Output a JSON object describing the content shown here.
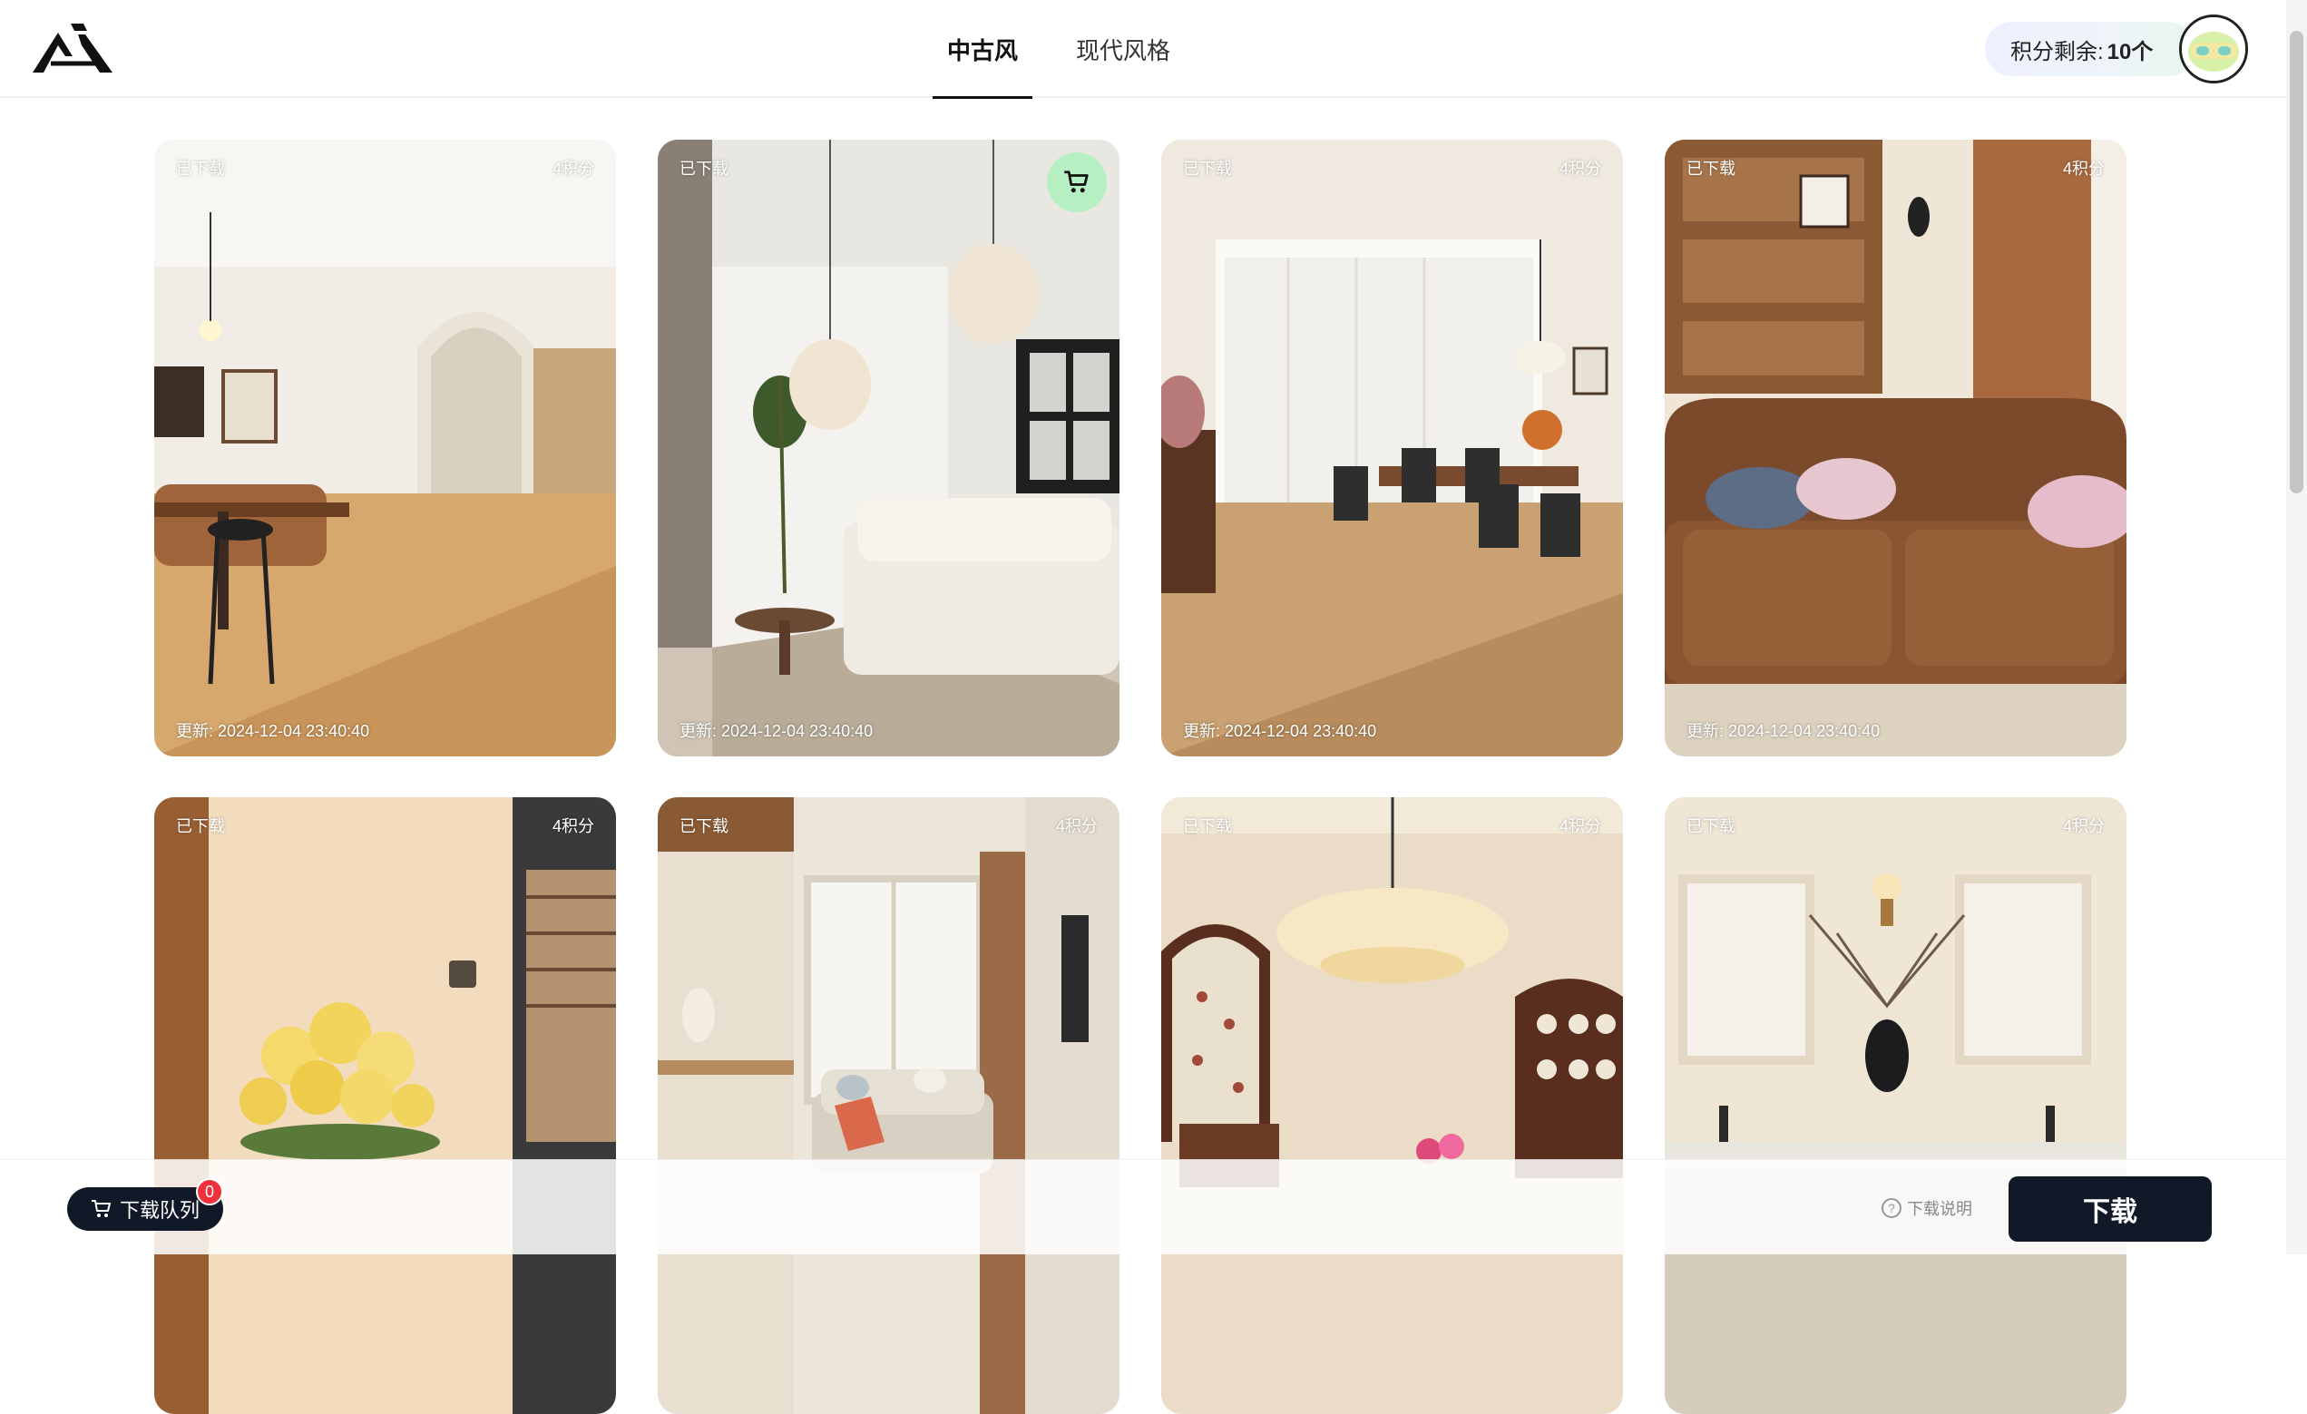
{
  "header": {
    "logo": "A-logo",
    "tabs": [
      {
        "label": "中古风",
        "active": true
      },
      {
        "label": "现代风格",
        "active": false
      }
    ],
    "points": {
      "label": "积分剩余:",
      "value": "10个"
    },
    "avatar_icon": "avatar-icon"
  },
  "cards": [
    {
      "downloaded": "已下载",
      "cost": "4积分",
      "updated": "更新: 2024-12-04 23:40:40",
      "scene": "arched-hallway-dining"
    },
    {
      "downloaded": "已下载",
      "cost": "",
      "updated": "更新: 2024-12-04 23:40:40",
      "scene": "living-room-pendant-lamps",
      "cart_icon": "cart-icon"
    },
    {
      "downloaded": "已下载",
      "cost": "4积分",
      "updated": "更新: 2024-12-04 23:40:40",
      "scene": "dining-room-sheer-curtains"
    },
    {
      "downloaded": "已下载",
      "cost": "4积分",
      "updated": "更新: 2024-12-04 23:40:40",
      "scene": "brown-leather-sofa"
    },
    {
      "downloaded": "已下载",
      "cost": "4积分",
      "scene": "yellow-roses-hallway"
    },
    {
      "downloaded": "已下载",
      "cost": "4积分",
      "scene": "cream-sofa-window"
    },
    {
      "downloaded": "已下载",
      "cost": "4积分",
      "scene": "chandelier-dining"
    },
    {
      "downloaded": "已下载",
      "cost": "4积分",
      "scene": "bathroom-vanity"
    }
  ],
  "bottom": {
    "queue_label": "下载队列",
    "queue_count": "0",
    "help_label": "下载说明",
    "download_label": "下载"
  },
  "colors": {
    "primary_dark": "#111827",
    "badge_red": "#f0303a",
    "cart_green": "#b6f0c2"
  }
}
